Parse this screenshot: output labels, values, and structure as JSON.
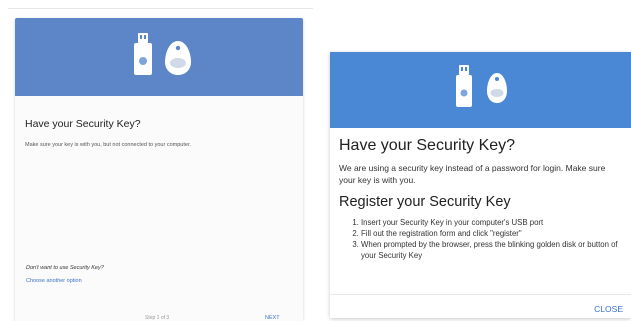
{
  "left_dialog": {
    "title": "Have your Security Key?",
    "description": "Make sure your key is with you, but not connected to your computer.",
    "dont_want_text": "Don't want to use Security Key?",
    "choose_another_link": "Choose another option",
    "step_text": "Step 1 of 3",
    "next_button": "NEXT"
  },
  "right_dialog": {
    "title": "Have your Security Key?",
    "description": "We are using a security key instead of a password for login. Make sure your key is with you.",
    "register_title": "Register your Security Key",
    "steps": [
      "Insert your Security Key in your computer's USB port",
      "Fill out the registration form and click \"register\"",
      "When prompted by the browser, press the blinking golden disk or button of your Security Key"
    ],
    "close_button": "CLOSE"
  },
  "icons": {
    "usb": "usb-security-key-icon",
    "fob": "key-fob-icon"
  },
  "colors": {
    "left_banner": "#5c86c8",
    "right_banner": "#4a87d4",
    "link": "#3a73c8"
  }
}
